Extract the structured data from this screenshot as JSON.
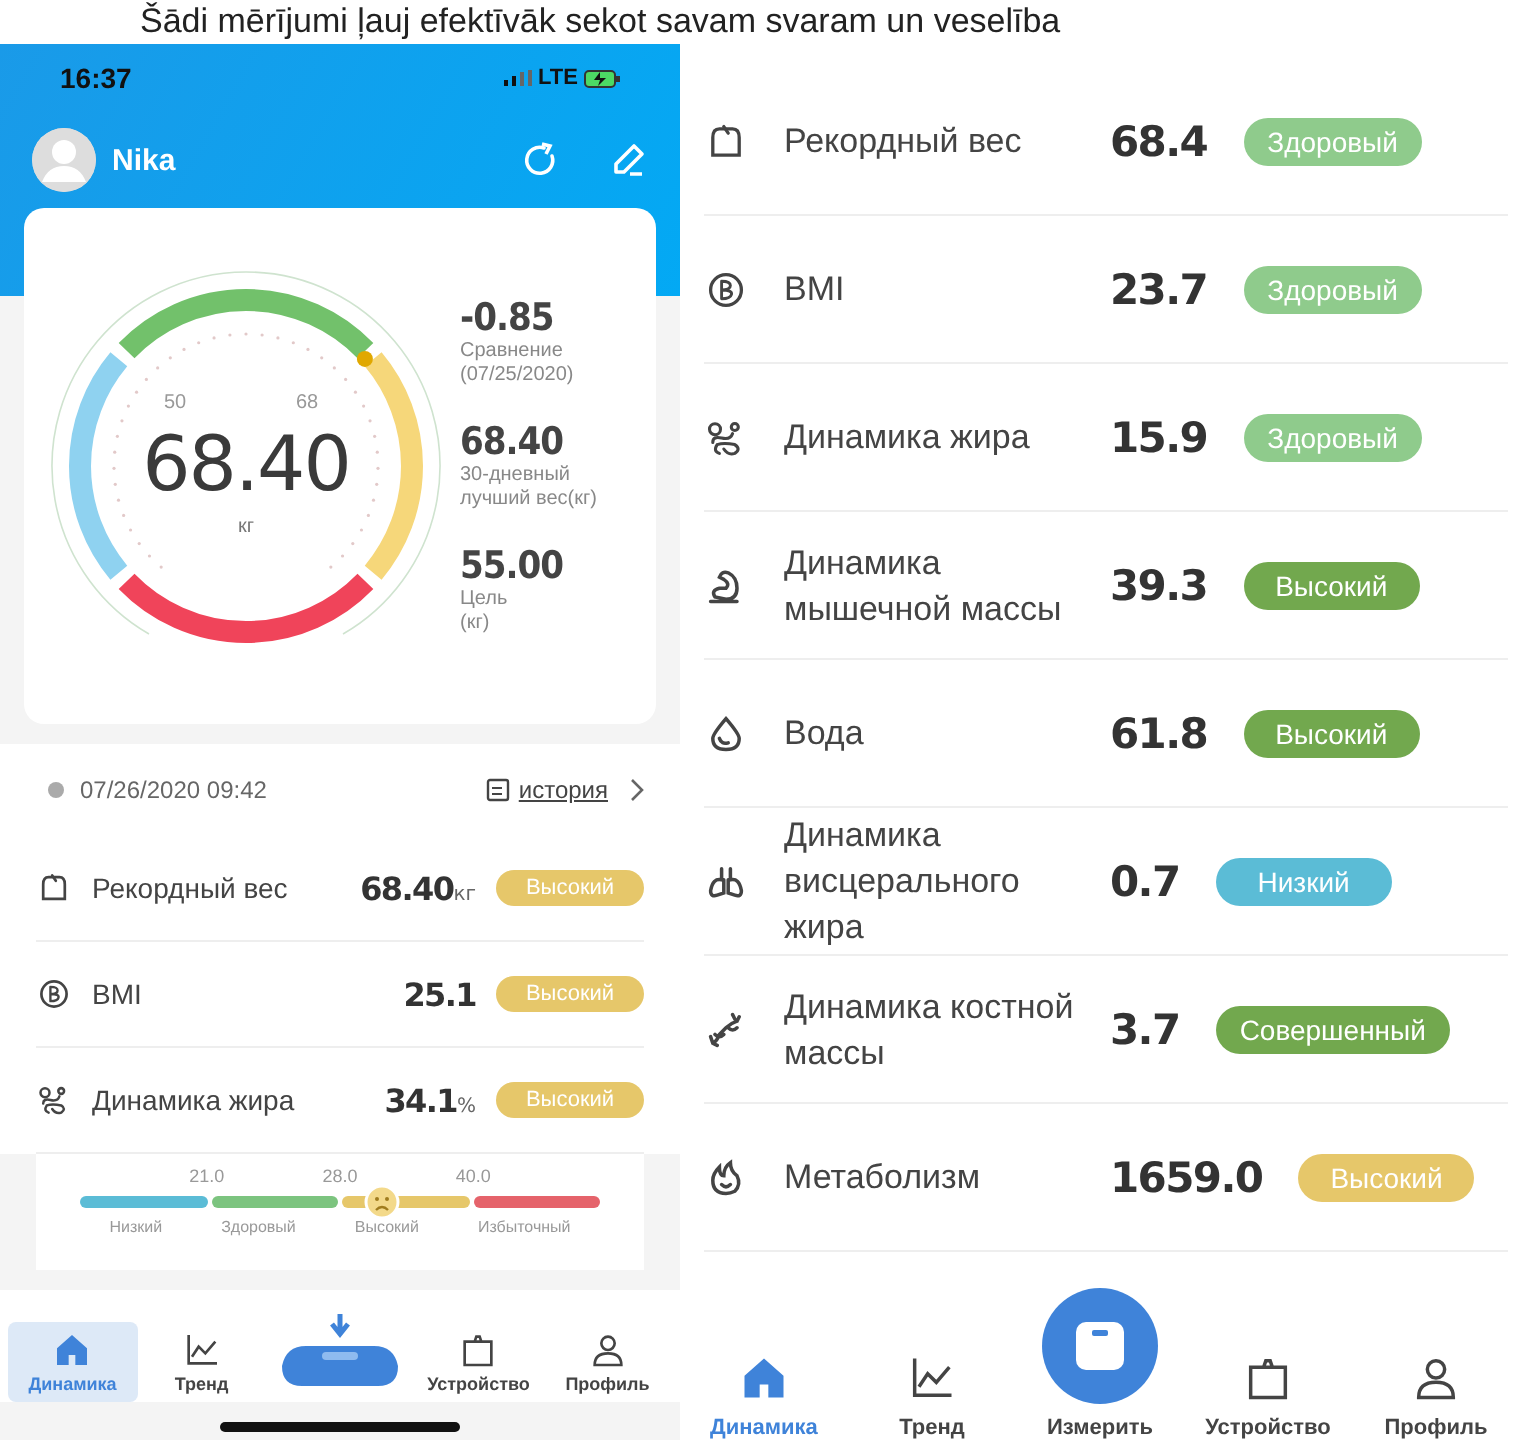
{
  "caption": "Šādi mērījumi ļauj efektīvāk sekot savam svaram un veselība",
  "left_phone": {
    "status_bar": {
      "time": "16:37",
      "network": "LTE"
    },
    "profile": {
      "name": "Nika"
    },
    "gauge": {
      "value": "68.40",
      "unit": "кг",
      "scale_labels": [
        "50",
        "68"
      ]
    },
    "stats": [
      {
        "value": "-0.85",
        "label": "Сравнение\n(07/25/2020)"
      },
      {
        "value": "68.40",
        "label": "30-дневный\n лучший вес(кг)"
      },
      {
        "value": "55.00",
        "label": "Цель\n(кг)"
      }
    ],
    "timestamp": "07/26/2020 09:42",
    "history_link": "история",
    "rows": [
      {
        "kind": "weight",
        "name": "Рекордный вес",
        "value": "68.40",
        "unit": "кг",
        "status": "Высокий",
        "color": "#e6c76a"
      },
      {
        "kind": "bmi",
        "name": "BMI",
        "value": "25.1",
        "status": "Высокий",
        "color": "#e6c76a"
      },
      {
        "kind": "fat",
        "name": "Динамика жира",
        "value": "34.1",
        "unit": "%",
        "status": "Высокий",
        "color": "#e6c76a"
      }
    ],
    "range_bar": {
      "ticks": [
        "21.0",
        "28.0",
        "40.0"
      ],
      "level": 0.58,
      "segments": [
        {
          "label": "Низкий",
          "color": "#5bbcd6"
        },
        {
          "label": "Здоровый",
          "color": "#7cc47f"
        },
        {
          "label": "Высокий",
          "color": "#e6c76a"
        },
        {
          "label": "Избыточный",
          "color": "#e5636b"
        }
      ]
    },
    "nav": [
      {
        "kind": "home",
        "label": "Динамика",
        "selected": true
      },
      {
        "kind": "trend",
        "label": "Тренд",
        "selected": false
      },
      {
        "kind": "scale",
        "selected": false
      },
      {
        "kind": "device",
        "label": "Устройство",
        "selected": false
      },
      {
        "kind": "profile",
        "label": "Профиль",
        "selected": false
      }
    ]
  },
  "right_phone": {
    "rows": [
      {
        "kind": "weight",
        "name": "Рекордный вес",
        "value": "68.4",
        "status": "Здоровый",
        "color": "#8fcb8c"
      },
      {
        "kind": "bmi",
        "name": "BMI",
        "value": "23.7",
        "status": "Здоровый",
        "color": "#8fcb8c"
      },
      {
        "kind": "fat",
        "name": "Динамика жира",
        "value": "15.9",
        "status": "Здоровый",
        "color": "#8fcb8c"
      },
      {
        "kind": "muscle",
        "name": "Динамика мышечной массы",
        "value": "39.3",
        "status": "Высокий",
        "color": "#72a84e"
      },
      {
        "kind": "water",
        "name": "Вода",
        "value": "61.8",
        "status": "Высокий",
        "color": "#72a84e"
      },
      {
        "kind": "visceral",
        "name": "Динамика висцерального жира",
        "value": "0.7",
        "status": "Низкий",
        "color": "#5bbcd6"
      },
      {
        "kind": "bone",
        "name": "Динамика костной массы",
        "value": "3.7",
        "status": "Совершенный",
        "color": "#72a84e"
      },
      {
        "kind": "metabolism",
        "name": "Метаболизм",
        "value": "1659.0",
        "status": "Высокий",
        "color": "#e6c76a"
      }
    ],
    "nav": [
      {
        "kind": "home",
        "label": "Динамика",
        "selected": true
      },
      {
        "kind": "trend",
        "label": "Тренд",
        "selected": false
      },
      {
        "kind": "measure",
        "label": "Измерить",
        "selected": false
      },
      {
        "kind": "device",
        "label": "Устройство",
        "selected": false
      },
      {
        "kind": "profile",
        "label": "Профиль",
        "selected": false
      }
    ]
  }
}
